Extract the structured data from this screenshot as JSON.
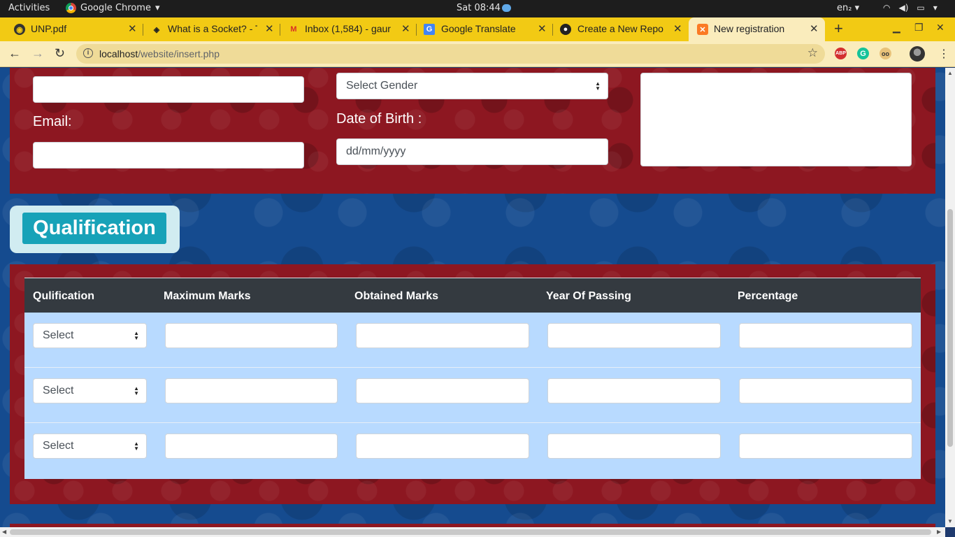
{
  "system_bar": {
    "activities": "Activities",
    "app_name": "Google Chrome",
    "clock": "Sat 08:44",
    "input_lang": "en₂"
  },
  "tabs": [
    {
      "title": "UNP.pdf",
      "icon": "pdf-favicon"
    },
    {
      "title": "What is a Socket? - T",
      "icon": "socket-favicon"
    },
    {
      "title": "Inbox (1,584) - gaur",
      "icon": "gmail-favicon"
    },
    {
      "title": "Google Translate",
      "icon": "translate-favicon"
    },
    {
      "title": "Create a New Repo",
      "icon": "github-favicon"
    },
    {
      "title": "New registration",
      "icon": "xampp-favicon",
      "active": true
    }
  ],
  "address_bar": {
    "host": "localhost",
    "path": "/website/insert.php"
  },
  "extensions": [
    "ABP",
    "G",
    "oo"
  ],
  "form": {
    "email_label": "Email:",
    "gender_select": "Select Gender",
    "dob_label": "Date of Birth :",
    "dob_placeholder": "dd/mm/yyyy"
  },
  "qualification": {
    "heading": "Qualification",
    "columns": [
      "Qulification",
      "Maximum Marks",
      "Obtained Marks",
      "Year Of Passing",
      "Percentage"
    ],
    "rows": [
      {
        "select": "Select"
      },
      {
        "select": "Select"
      },
      {
        "select": "Select"
      }
    ]
  },
  "colors": {
    "tab_strip": "#f2ca14",
    "active_tab": "#faecbc",
    "panel_red": "#8d1721",
    "background_blue": "#154b8f",
    "qualification_button": "#17a2b8",
    "table_header": "#343a40",
    "table_body": "#b8daff"
  }
}
